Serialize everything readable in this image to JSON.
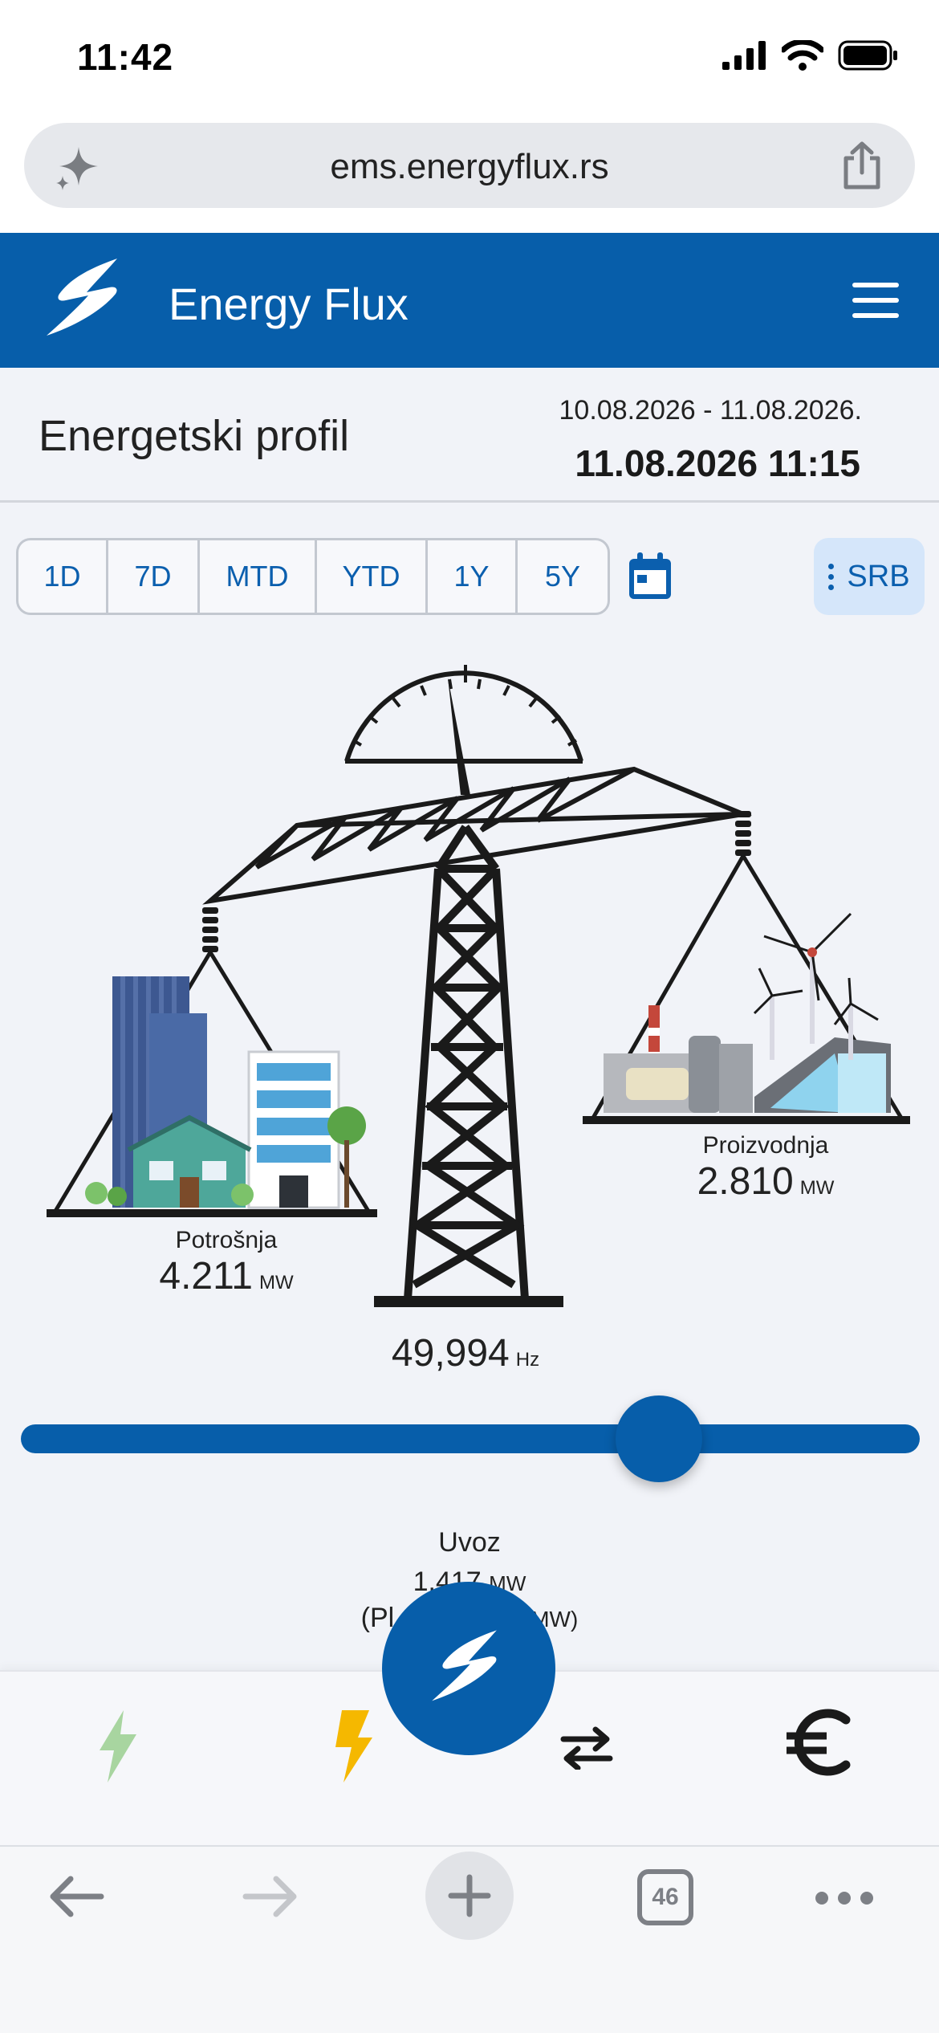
{
  "status_bar": {
    "time": "11:42"
  },
  "browser": {
    "url": "ems.energyflux.rs",
    "tab_count": "46"
  },
  "app": {
    "title": "Energy Flux"
  },
  "profile": {
    "title": "Energetski profil",
    "date_range": "10.08.2026 - 11.08.2026.",
    "current_datetime": "11.08.2026 11:15"
  },
  "periods": [
    "1D",
    "7D",
    "MTD",
    "YTD",
    "1Y",
    "5Y"
  ],
  "region": {
    "label": "SRB"
  },
  "metrics": {
    "consumption": {
      "label": "Potrošnja",
      "value": "4.211",
      "unit": "MW"
    },
    "production": {
      "label": "Proizvodnja",
      "value": "2.810",
      "unit": "MW"
    },
    "frequency": {
      "value": "49,994",
      "unit": "Hz"
    }
  },
  "balance_slider": {
    "position": 0.71
  },
  "import": {
    "label": "Uvoz",
    "value": "1.417",
    "unit": "MW",
    "sub_prefix": "(Pl",
    "sub_suffix": "MW)"
  },
  "colors": {
    "brand_blue": "#075eaa",
    "accent_light": "#d5e6fa",
    "renewable_green": "#a8d5a0",
    "lightning_yellow": "#f5b800"
  },
  "bottom_nav": {
    "icons": [
      "renewable-icon",
      "lightning-icon",
      "energy-flux-fab-icon",
      "exchange-icon",
      "euro-icon"
    ]
  }
}
